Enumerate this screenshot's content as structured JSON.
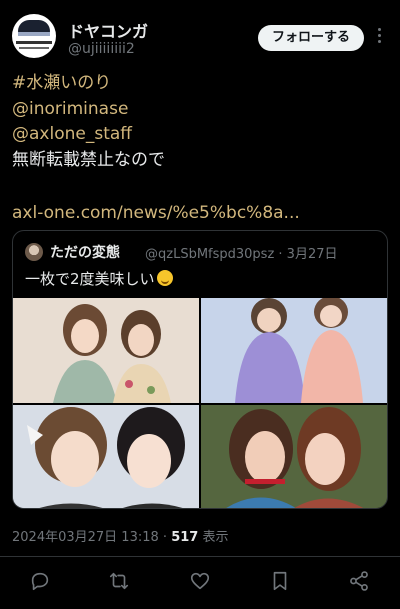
{
  "tweet": {
    "author_name": "ドヤコンガ",
    "author_handle": "@ujiiiiiiii2",
    "follow_label": "フォローする",
    "lines": [
      "#水瀬いのり",
      "@inoriminase",
      "@axlone_staff",
      "無断転載禁止なので"
    ],
    "url": "axl-one.com/news/%e5%bc%8a...",
    "timestamp": "2024年03月27日 13:18",
    "separator": "·",
    "views_count": "517",
    "views_label": "表示"
  },
  "quoted": {
    "author_name": "ただの変態",
    "meta": "@qzLSbMfspd30psz · 3月27日",
    "text": "一枚で2度美味しい"
  },
  "icons": {
    "more": "more-vertical-icon",
    "reply": "reply-icon",
    "retweet": "retweet-icon",
    "like": "heart-icon",
    "bookmark": "bookmark-icon",
    "share": "share-icon",
    "emoji": "smiling-face-icon"
  },
  "colors": {
    "background": "#000000",
    "link": "#d2b77d",
    "muted": "#71767b",
    "text": "#e7e9ea"
  }
}
